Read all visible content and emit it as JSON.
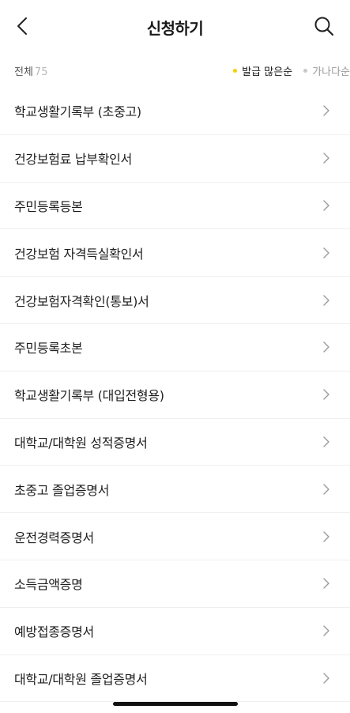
{
  "header": {
    "title": "신청하기",
    "back_icon": "chevron-left-icon",
    "search_icon": "search-icon"
  },
  "filter": {
    "count_label": "전체",
    "count_value": "75",
    "sort_options": [
      {
        "label": "발급 많은순",
        "active": true
      },
      {
        "label": "가나다순",
        "active": false
      }
    ],
    "active_dot_color": "#f7d000"
  },
  "items": [
    {
      "label": "학교생활기록부 (초중고)"
    },
    {
      "label": "건강보험료 납부확인서"
    },
    {
      "label": "주민등록등본"
    },
    {
      "label": "건강보험 자격득실확인서"
    },
    {
      "label": "건강보험자격확인(통보)서"
    },
    {
      "label": "주민등록초본"
    },
    {
      "label": "학교생활기록부 (대입전형용)"
    },
    {
      "label": "대학교/대학원 성적증명서"
    },
    {
      "label": "초중고 졸업증명서"
    },
    {
      "label": "운전경력증명서"
    },
    {
      "label": "소득금액증명"
    },
    {
      "label": "예방접종증명서"
    },
    {
      "label": "대학교/대학원 졸업증명서"
    }
  ]
}
